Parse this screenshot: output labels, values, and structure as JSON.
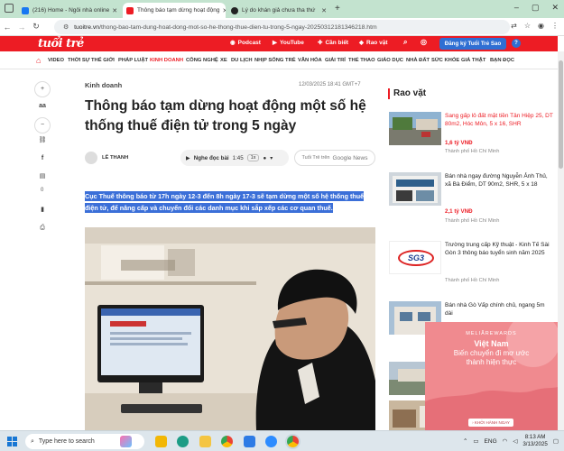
{
  "browser": {
    "tabs": [
      {
        "label": "(216) Home - Ngôi nhà online",
        "active": false
      },
      {
        "label": "Thông báo tạm dừng hoạt động",
        "active": true
      },
      {
        "label": "Lý do khán giả chưa tha thứ",
        "active": false
      }
    ],
    "new_tab": "+",
    "url_host": "tuoitre.vn",
    "url_path": "/thong-bao-tam-dung-hoat-dong-mot-so-he-thong-thue-dien-tu-trong-5-ngay-20250312181346218.htm"
  },
  "site": {
    "logo": "tuổi trẻ",
    "header_links": [
      "Podcast",
      "YouTube",
      "Cần biết",
      "Rao vặt"
    ],
    "subscribe": "Đăng ký Tuổi Trẻ Sao",
    "help": "?",
    "categories": [
      "VIDEO",
      "THỜI SỰ",
      "THẾ GIỚI",
      "PHÁP LUẬT",
      "KINH DOANH",
      "CÔNG NGHỆ",
      "XE",
      "DU LỊCH",
      "NHỊP SỐNG TRẺ",
      "VĂN HÓA",
      "GIẢI TRÍ",
      "THỂ THAO",
      "GIÁO DỤC",
      "NHÀ ĐẤT",
      "SỨC KHỎE",
      "GIẢ THẬT",
      "BẠN ĐỌC"
    ],
    "active_category": "KINH DOANH"
  },
  "rail": {
    "font_label": "aa",
    "comment_count": "0"
  },
  "article": {
    "section": "Kinh doanh",
    "datetime": "12/03/2025 18:41 GMT+7",
    "title": "Thông báo tạm dừng hoạt động một số hệ thống thuế điện tử trong 5 ngày",
    "author": "LÊ THANH",
    "listen_label": "Nghe đọc bài",
    "listen_time": "1:45",
    "speed": "1x",
    "gnews_prefix": "Tuổi Trẻ trên",
    "gnews_brand": "Google News",
    "lead": "Cục Thuế thông báo từ 17h ngày 12-3 đến 8h ngày 17-3 sẽ tạm dừng một số hệ thống thuế điện tử, để nâng cấp và chuyển đổi các danh mục khi sắp xếp các cơ quan thuế."
  },
  "sidebar": {
    "title": "Rao vặt",
    "items": [
      {
        "title": "Sang gấp lô đất mặt tiền Tân Hiệp 25, DT 80m2, Hóc Môn, 5 x 16, SHR",
        "price": "1,6 tỷ VNĐ",
        "location": "Thành phố Hồ Chí Minh",
        "highlight": true
      },
      {
        "title": "Bán nhà ngay đường Nguyễn Ảnh Thủ, xã Bà Điểm, DT 90m2, SHR, 5 x 18",
        "price": "2,1 tỷ VNĐ",
        "location": "Thành phố Hồ Chí Minh",
        "highlight": false
      },
      {
        "title": "Trường trung cấp Kỹ thuật - Kinh Tế Sài Gòn 3 thông báo tuyển sinh năm 2025",
        "price": "",
        "location": "Thành phố Hồ Chí Minh",
        "highlight": false,
        "thumb_text": "SG3"
      },
      {
        "title": "Bán nhà Gò Vấp chính chủ, ngang 5m dài",
        "price": "",
        "location": "",
        "highlight": false
      }
    ]
  },
  "ad": {
    "brand": "MELIÃREWARDS",
    "line1": "Việt Nam",
    "line2": "Biến chuyển đi mơ ước",
    "line3": "thành hiện thực",
    "cta": "› KHỞI HÀNH NGAY"
  },
  "taskbar": {
    "search_placeholder": "Type here to search",
    "lang": "ENG",
    "time": "8:13 AM",
    "date": "3/13/2025"
  }
}
